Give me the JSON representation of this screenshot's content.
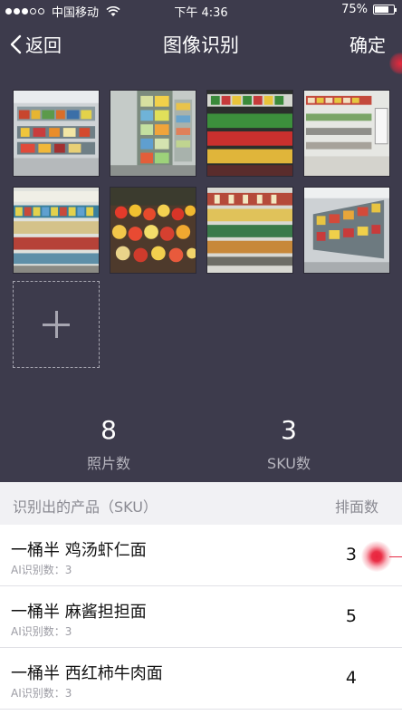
{
  "status_bar": {
    "carrier": "中国移动",
    "time": "下午 4:36",
    "battery": "75%"
  },
  "nav": {
    "back_label": "返回",
    "title": "图像识别",
    "confirm_label": "确定"
  },
  "stats": {
    "photo_count": "8",
    "photo_label": "照片数",
    "sku_count": "3",
    "sku_label": "SKU数"
  },
  "list": {
    "header_left": "识别出的产品（SKU）",
    "header_right": "排面数",
    "items": [
      {
        "name": "一桶半 鸡汤虾仁面",
        "ai": "AI识别数：3",
        "count": "3"
      },
      {
        "name": "一桶半 麻酱担担面",
        "ai": "AI识别数：3",
        "count": "5"
      },
      {
        "name": "一桶半 西红柿牛肉面",
        "ai": "AI识别数：3",
        "count": "4"
      }
    ]
  },
  "colors": {
    "top_bg": "#3d3b4c",
    "header_bg": "#f1f1f4",
    "accent_touch": "#e62a45"
  }
}
